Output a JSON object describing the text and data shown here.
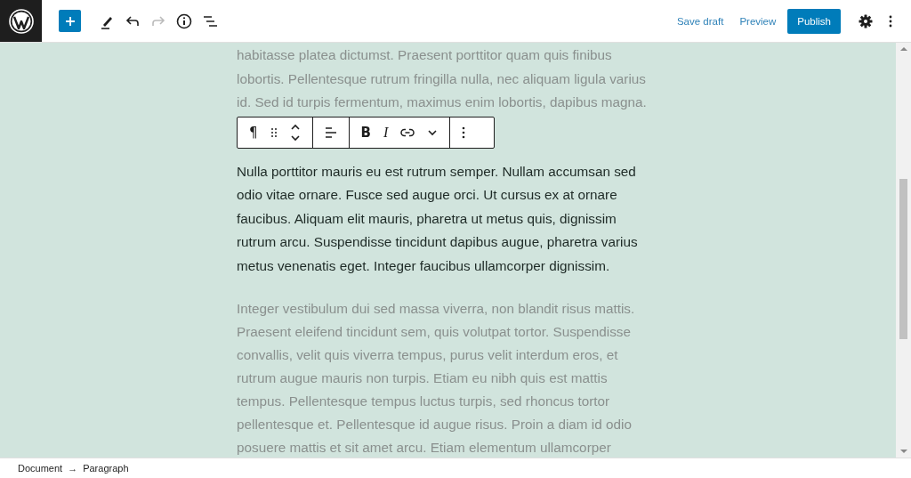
{
  "header": {
    "actions": [
      {
        "label": "Save draft",
        "kind": "link"
      },
      {
        "label": "Preview",
        "kind": "link"
      },
      {
        "label": "Publish",
        "kind": "primary"
      }
    ]
  },
  "block_toolbar": {
    "block_type": "¶",
    "bold": "B",
    "italic": "I"
  },
  "paragraphs": [
    {
      "text": "habitasse platea dictumst. Praesent porttitor quam quis finibus lobortis. Pellentesque rutrum fringilla nulla, nec aliquam ligula varius id. Sed id turpis fermentum, maximus enim lobortis, dapibus magna.",
      "selected": false
    },
    {
      "text": "Nulla porttitor mauris eu est rutrum semper. Nullam accumsan sed odio vitae ornare. Fusce sed augue orci. Ut cursus ex at ornare faucibus. Aliquam elit mauris, pharetra ut metus quis, dignissim rutrum arcu. Suspendisse tincidunt dapibus augue, pharetra varius metus venenatis eget. Integer faucibus ullamcorper dignissim.",
      "selected": true
    },
    {
      "text": "Integer vestibulum dui sed massa viverra, non blandit risus mattis. Praesent eleifend tincidunt sem, quis volutpat tortor. Suspendisse convallis, velit quis viverra tempus, purus velit interdum eros, et rutrum augue mauris non turpis. Etiam eu nibh quis est mattis tempus. Pellentesque tempus luctus turpis, sed rhoncus tortor pellentesque et. Pellentesque id augue risus. Proin a diam id odio posuere mattis et sit amet arcu. Etiam elementum ullamcorper",
      "selected": false
    }
  ],
  "breadcrumb": [
    "Document",
    "→",
    "Paragraph"
  ]
}
